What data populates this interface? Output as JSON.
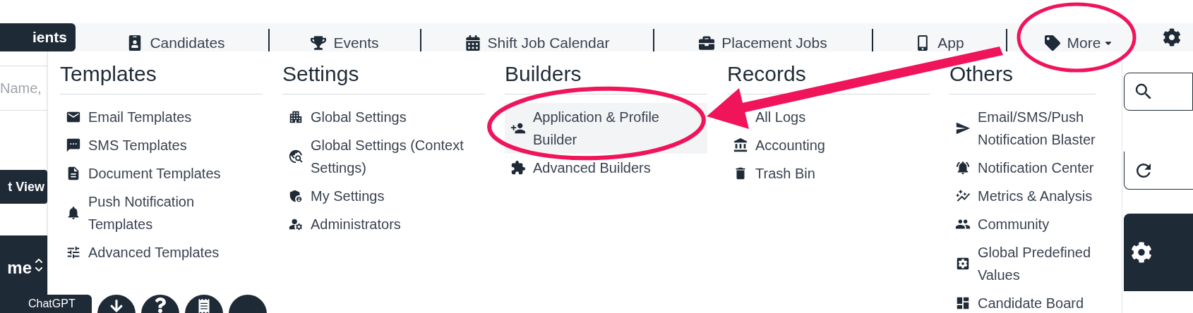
{
  "nav": {
    "tabs": [
      {
        "label": "ients",
        "selected": true,
        "kind": "link"
      },
      {
        "label": "Candidates",
        "selected": false,
        "kind": "link"
      },
      {
        "label": "Events",
        "selected": false,
        "kind": "link"
      },
      {
        "label": "Shift Job Calendar",
        "selected": false,
        "kind": "link"
      },
      {
        "label": "Placement Jobs",
        "selected": false,
        "kind": "link"
      },
      {
        "label": "App",
        "selected": false,
        "kind": "link"
      },
      {
        "label": "More",
        "selected": false,
        "kind": "dropdown"
      }
    ]
  },
  "background": {
    "search_placeholder": "Name,",
    "view_button": "t View",
    "table_header": "me",
    "chat_tag": "ChatGPT"
  },
  "menu": {
    "columns": [
      {
        "title": "Templates",
        "items": [
          {
            "label": "Email Templates",
            "selected": false
          },
          {
            "label": "SMS Templates",
            "selected": false
          },
          {
            "label": "Document Templates",
            "selected": false
          },
          {
            "label": "Push Notification Templates",
            "selected": false
          },
          {
            "label": "Advanced Templates",
            "selected": false
          }
        ]
      },
      {
        "title": "Settings",
        "items": [
          {
            "label": "Global Settings",
            "selected": false
          },
          {
            "label": "Global Settings (Context Settings)",
            "selected": false
          },
          {
            "label": "My Settings",
            "selected": false
          },
          {
            "label": "Administrators",
            "selected": false
          }
        ]
      },
      {
        "title": "Builders",
        "items": [
          {
            "label": "Application & Profile Builder",
            "selected": true
          },
          {
            "label": "Advanced Builders",
            "selected": false
          }
        ]
      },
      {
        "title": "Records",
        "items": [
          {
            "label": "All Logs",
            "selected": false
          },
          {
            "label": "Accounting",
            "selected": false
          },
          {
            "label": "Trash Bin",
            "selected": false
          }
        ]
      },
      {
        "title": "Others",
        "items": [
          {
            "label": "Email/SMS/Push Notification Blaster",
            "selected": false
          },
          {
            "label": "Notification Center",
            "selected": false
          },
          {
            "label": "Metrics & Analysis",
            "selected": false
          },
          {
            "label": "Community",
            "selected": false
          },
          {
            "label": "Global Predefined Values",
            "selected": false
          },
          {
            "label": "Candidate Board",
            "selected": false
          }
        ]
      }
    ]
  }
}
